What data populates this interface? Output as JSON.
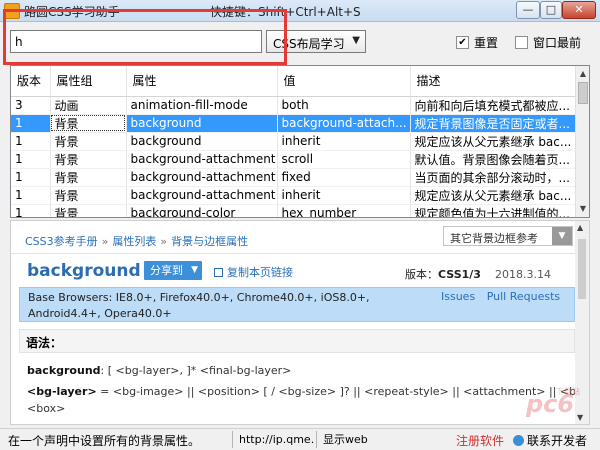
{
  "window": {
    "title": "路圆CSS学习助手",
    "hint": "快捷键：Shift+Ctrl+Alt+S",
    "min_label": "—",
    "max_label": "□",
    "close_label": "✕"
  },
  "toolbar": {
    "search_value": "h",
    "category_select": "CSS布局学习",
    "reset_label": "重置",
    "reset_checked": "✔",
    "top_label": "窗口最前"
  },
  "table": {
    "columns": [
      "版本",
      "属性组",
      "属性",
      "值",
      "描述"
    ],
    "rows": [
      [
        "3",
        "动画",
        "animation-fill-mode",
        "both",
        "向前和向后填充模式都被应..."
      ],
      [
        "1",
        "背景",
        "background",
        "background-attach...",
        "规定背景图像是否固定或者..."
      ],
      [
        "1",
        "背景",
        "background",
        "inherit",
        "规定应该从父元素继承 bac..."
      ],
      [
        "1",
        "背景",
        "background-attachment",
        "scroll",
        "默认值。背景图像会随着页..."
      ],
      [
        "1",
        "背景",
        "background-attachment",
        "fixed",
        "当页面的其余部分滚动时，..."
      ],
      [
        "1",
        "背景",
        "background-attachment",
        "inherit",
        "规定应该从父元素继承 bac..."
      ],
      [
        "1",
        "背景",
        "background-color",
        "hex_number",
        "规定颜色值为十六进制值的..."
      ]
    ],
    "selected_row": 1
  },
  "doc": {
    "breadcrumb": [
      "CSS3参考手册",
      "属性列表",
      "背景与边框属性"
    ],
    "breadcrumb_sep": "»",
    "other_ref": "其它背景边框参考",
    "property": "background",
    "share_label": "分享到",
    "copy_link_label": "复制本页链接",
    "version_label": "版本：",
    "version_value": "CSS1/3",
    "date": "2018.3.14",
    "browsers": "Base Browsers: IE8.0+, Firefox40.0+, Chrome40.0+, iOS8.0+, Android4.4+, Opera40.0+",
    "issues_label": "Issues",
    "pull_label": "Pull Requests",
    "syntax_label": "语法：",
    "code1_name": "background",
    "code1_rest": ": [ <bg-layer>, ]* <final-bg-layer>",
    "code2_name": "<bg-layer>",
    "code2_rest": " = <bg-image> || <position> [ / <bg-size> ]? || <repeat-style> || <attachment> || <box> ||",
    "code3": "<box>"
  },
  "status": {
    "description": "在一个声明中设置所有的背景属性。",
    "url": "http://ip.qme.na",
    "view": "显示web",
    "register": "注册软件",
    "contact": "联系开发者"
  },
  "watermark": {
    "text": "pc6",
    "sub": "下载站"
  },
  "colors": {
    "accent": "#2c6cb0",
    "selection": "#3399ff",
    "highlight_box": "#e53935"
  }
}
